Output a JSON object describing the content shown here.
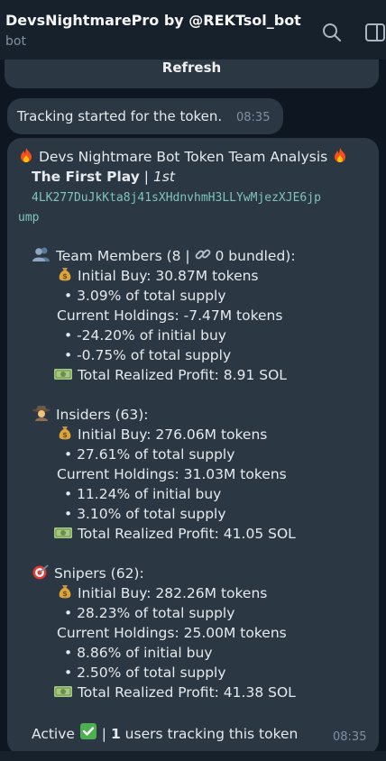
{
  "header": {
    "title": "DevsNightmarePro by @REKTsol_bot",
    "subtitle": "bot",
    "icons": [
      "search-icon",
      "sidebar-toggle-icon"
    ]
  },
  "previous_message": {
    "button_label": "Refresh"
  },
  "status_message": {
    "text": "Tracking started for the token.",
    "time": "08:35"
  },
  "analysis": {
    "title": "Devs Nightmare Bot Token Team Analysis",
    "token_name": "The First Play",
    "separator": " | ",
    "token_tag": "1st",
    "address_line1": "4LK277DuJkKta8j41sXHdnvhmH3LLYwMjezXJE6jp",
    "address_line2": "ump",
    "team": {
      "heading": "Team Members (8 | ",
      "bundled": " 0 bundled):",
      "initial_buy": "Initial Buy: 30.87M tokens",
      "initial_pct": "• 3.09% of total supply",
      "current": "Current Holdings: -7.47M tokens",
      "current_pct_initial": "• -24.20% of initial buy",
      "current_pct_total": "• -0.75% of total supply",
      "profit": "Total Realized Profit: 8.91 SOL"
    },
    "insiders": {
      "heading": "Insiders (63):",
      "initial_buy": "Initial Buy: 276.06M tokens",
      "initial_pct": "• 27.61% of total supply",
      "current": "Current Holdings: 31.03M tokens",
      "current_pct_initial": "• 11.24% of initial buy",
      "current_pct_total": "• 3.10% of total supply",
      "profit": "Total Realized Profit: 41.05 SOL"
    },
    "snipers": {
      "heading": "Snipers (62):",
      "initial_buy": "Initial Buy: 282.26M tokens",
      "initial_pct": "• 28.23% of total supply",
      "current": "Current Holdings: 25.00M tokens",
      "current_pct_initial": "• 8.86% of initial buy",
      "current_pct_total": "• 2.50% of total supply",
      "profit": "Total Realized Profit: 41.38 SOL"
    },
    "footer": {
      "active": "Active ",
      "sep": " | ",
      "count": "1",
      "tracking": " users tracking this token"
    },
    "time": "08:35"
  },
  "colors": {
    "background": "#0e1621",
    "header": "#17212b",
    "bubble": "#2b3742",
    "address": "#7fc4c0",
    "time": "#7f91a4"
  }
}
